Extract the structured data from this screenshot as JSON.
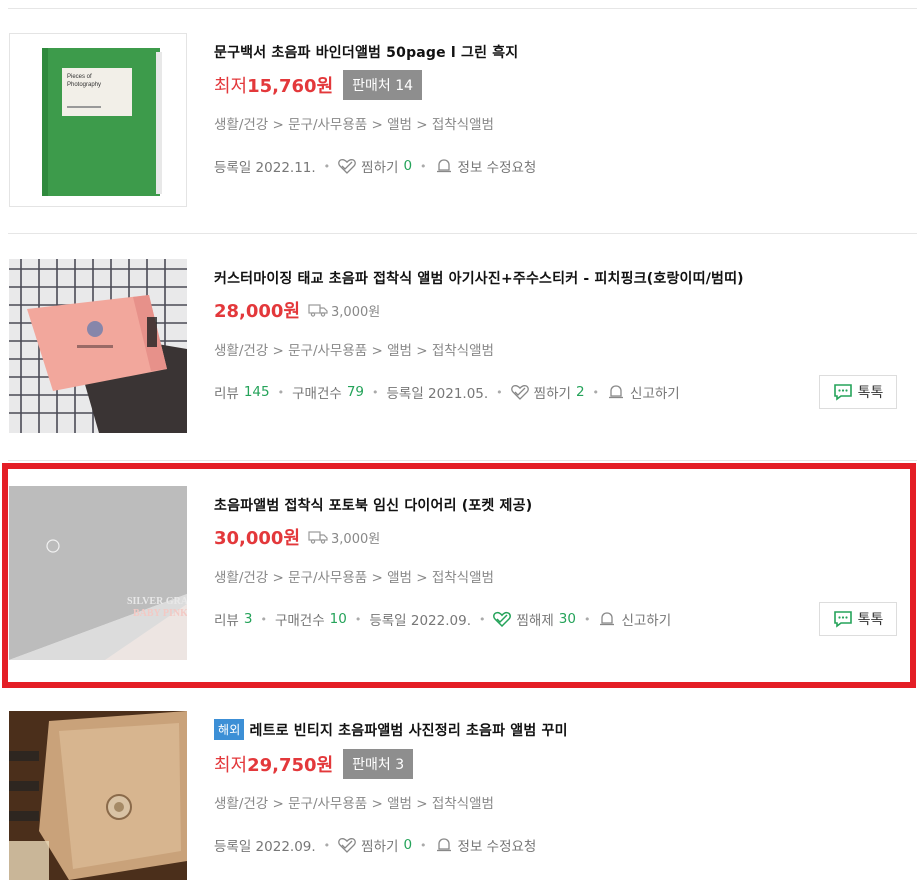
{
  "products": [
    {
      "title": "문구백서 초음파 바인더앨범 50page l 그린 흑지",
      "price_prefix": "최저",
      "price": "15,760원",
      "sellers": "판매처 14",
      "category": "생활/건강 > 문구/사무용품 > 앨범 > 접착식앨범",
      "registered": "등록일 2022.11.",
      "wish_label": "찜하기",
      "wish_count": "0",
      "report_label": "정보 수정요청",
      "thumb_text_1": "Pieces of",
      "thumb_text_2": "Photography"
    },
    {
      "title": "커스터마이징 태교 초음파 접착식 앨범 아기사진+주수스티커 - 피치핑크(호랑이띠/범띠)",
      "price": "28,000원",
      "shipping": "3,000원",
      "category": "생활/건강 > 문구/사무용품 > 앨범 > 접착식앨범",
      "review_label": "리뷰",
      "review_count": "145",
      "purchase_label": "구매건수",
      "purchase_count": "79",
      "registered": "등록일 2021.05.",
      "wish_label": "찜하기",
      "wish_count": "2",
      "report_label": "신고하기",
      "talk_label": "톡톡"
    },
    {
      "title": "초음파앨범 접착식 포토북 임신 다이어리 (포켓 제공)",
      "price": "30,000원",
      "shipping": "3,000원",
      "category": "생활/건강 > 문구/사무용품 > 앨범 > 접착식앨범",
      "review_label": "리뷰",
      "review_count": "3",
      "purchase_label": "구매건수",
      "purchase_count": "10",
      "registered": "등록일 2022.09.",
      "wish_label": "찜해제",
      "wish_count": "30",
      "report_label": "신고하기",
      "talk_label": "톡톡",
      "thumb_text_1": "SILVER GRAY",
      "thumb_text_2": "BABY PINK"
    },
    {
      "badge": "해외",
      "title": "레트로 빈티지 초음파앨범 사진정리 초음파 앨범 꾸미",
      "price_prefix": "최저",
      "price": "29,750원",
      "sellers": "판매처 3",
      "category": "생활/건강 > 문구/사무용품 > 앨범 > 접착식앨범",
      "registered": "등록일 2022.09.",
      "wish_label": "찜하기",
      "wish_count": "0",
      "report_label": "정보 수정요청"
    }
  ],
  "colors": {
    "price": "#e3383b",
    "count_green": "#25a35a",
    "highlight_border": "#e41e26",
    "overseas_badge": "#3c8fd6",
    "sellers_badge": "#8e8e8e"
  },
  "icons": [
    "heart-icon",
    "bell-icon",
    "truck-icon",
    "chat-icon"
  ]
}
